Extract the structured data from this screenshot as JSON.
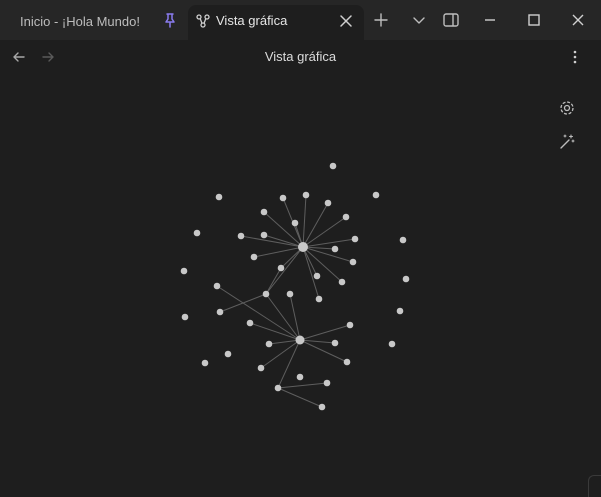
{
  "tabs": [
    {
      "label": "Inicio - ¡Hola Mundo!",
      "pinned": true
    },
    {
      "label": "Vista gráfica",
      "active": true
    }
  ],
  "view": {
    "title": "Vista gráfica"
  },
  "icons": {
    "pin": "pin-icon",
    "graph": "graph-icon",
    "close": "close-icon",
    "new_tab": "plus-icon",
    "tab_list": "chevron-down-icon",
    "sidebar": "sidebar-toggle-icon",
    "minimize": "minimize-icon",
    "maximize": "maximize-icon",
    "window_close": "window-close-icon",
    "back": "arrow-left-icon",
    "forward": "arrow-right-icon",
    "more": "more-vertical-icon",
    "settings": "gear-icon",
    "magic": "magic-wand-icon"
  },
  "colors": {
    "background": "#1e1e1e",
    "titlebar": "#262626",
    "node": "#c8c8c8",
    "edge": "#5e5e5e",
    "pin_accent": "#8a7cf0"
  }
}
